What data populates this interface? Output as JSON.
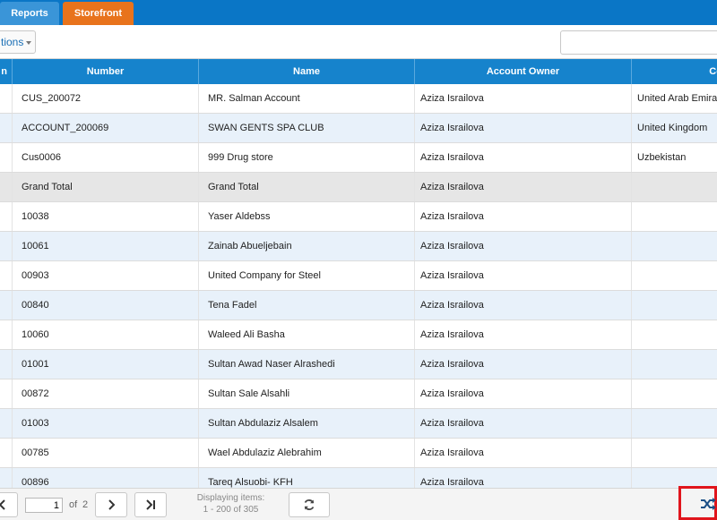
{
  "tabs": [
    {
      "label": "Reports"
    },
    {
      "label": "Storefront"
    }
  ],
  "toolbar": {
    "actions_label": "tions",
    "search_placeholder": ""
  },
  "grid": {
    "columns": [
      "n",
      "Number",
      "Name",
      "Account Owner",
      "Cou"
    ],
    "rows": [
      {
        "number": "CUS_200072",
        "name": "MR. Salman Account",
        "owner": "Aziza Israilova",
        "country": "United Arab Emira"
      },
      {
        "number": "ACCOUNT_200069",
        "name": "SWAN GENTS SPA CLUB",
        "owner": "Aziza Israilova",
        "country": "United Kingdom"
      },
      {
        "number": "Cus0006",
        "name": "999 Drug store",
        "owner": "Aziza Israilova",
        "country": "Uzbekistan"
      },
      {
        "number": "Grand Total",
        "name": "Grand Total",
        "owner": "Aziza Israilova",
        "country": ""
      },
      {
        "number": "10038",
        "name": "Yaser Aldebss",
        "owner": "Aziza Israilova",
        "country": ""
      },
      {
        "number": "10061",
        "name": "Zainab Abueljebain",
        "owner": "Aziza Israilova",
        "country": ""
      },
      {
        "number": "00903",
        "name": "United Company for Steel",
        "owner": "Aziza Israilova",
        "country": ""
      },
      {
        "number": "00840",
        "name": "Tena Fadel",
        "owner": "Aziza Israilova",
        "country": ""
      },
      {
        "number": "10060",
        "name": "Waleed Ali Basha",
        "owner": "Aziza Israilova",
        "country": ""
      },
      {
        "number": "01001",
        "name": "Sultan Awad Naser Alrashedi",
        "owner": "Aziza Israilova",
        "country": ""
      },
      {
        "number": "00872",
        "name": "Sultan Sale Alsahli",
        "owner": "Aziza Israilova",
        "country": ""
      },
      {
        "number": "01003",
        "name": "Sultan Abdulaziz Alsalem",
        "owner": "Aziza Israilova",
        "country": ""
      },
      {
        "number": "00785",
        "name": "Wael Abdulaziz Alebrahim",
        "owner": "Aziza Israilova",
        "country": ""
      },
      {
        "number": "00896",
        "name": "Tareq Alsuobi- KFH",
        "owner": "Aziza Israilova",
        "country": ""
      }
    ]
  },
  "pager": {
    "page_value": "1",
    "of_label": "of",
    "total_pages": "2",
    "displaying_label": "Displaying items:",
    "displaying_range": "1 - 200 of 305"
  },
  "icons": {
    "prev": "chevron-left-icon",
    "next": "chevron-right-icon",
    "last": "skip-last-icon",
    "refresh": "refresh-icon",
    "shuffle": "shuffle-icon"
  },
  "colors": {
    "header_blue": "#1683cc",
    "topbar_blue": "#0a76c6",
    "storefront_orange": "#e8731c",
    "highlight_red": "#e0151c"
  }
}
